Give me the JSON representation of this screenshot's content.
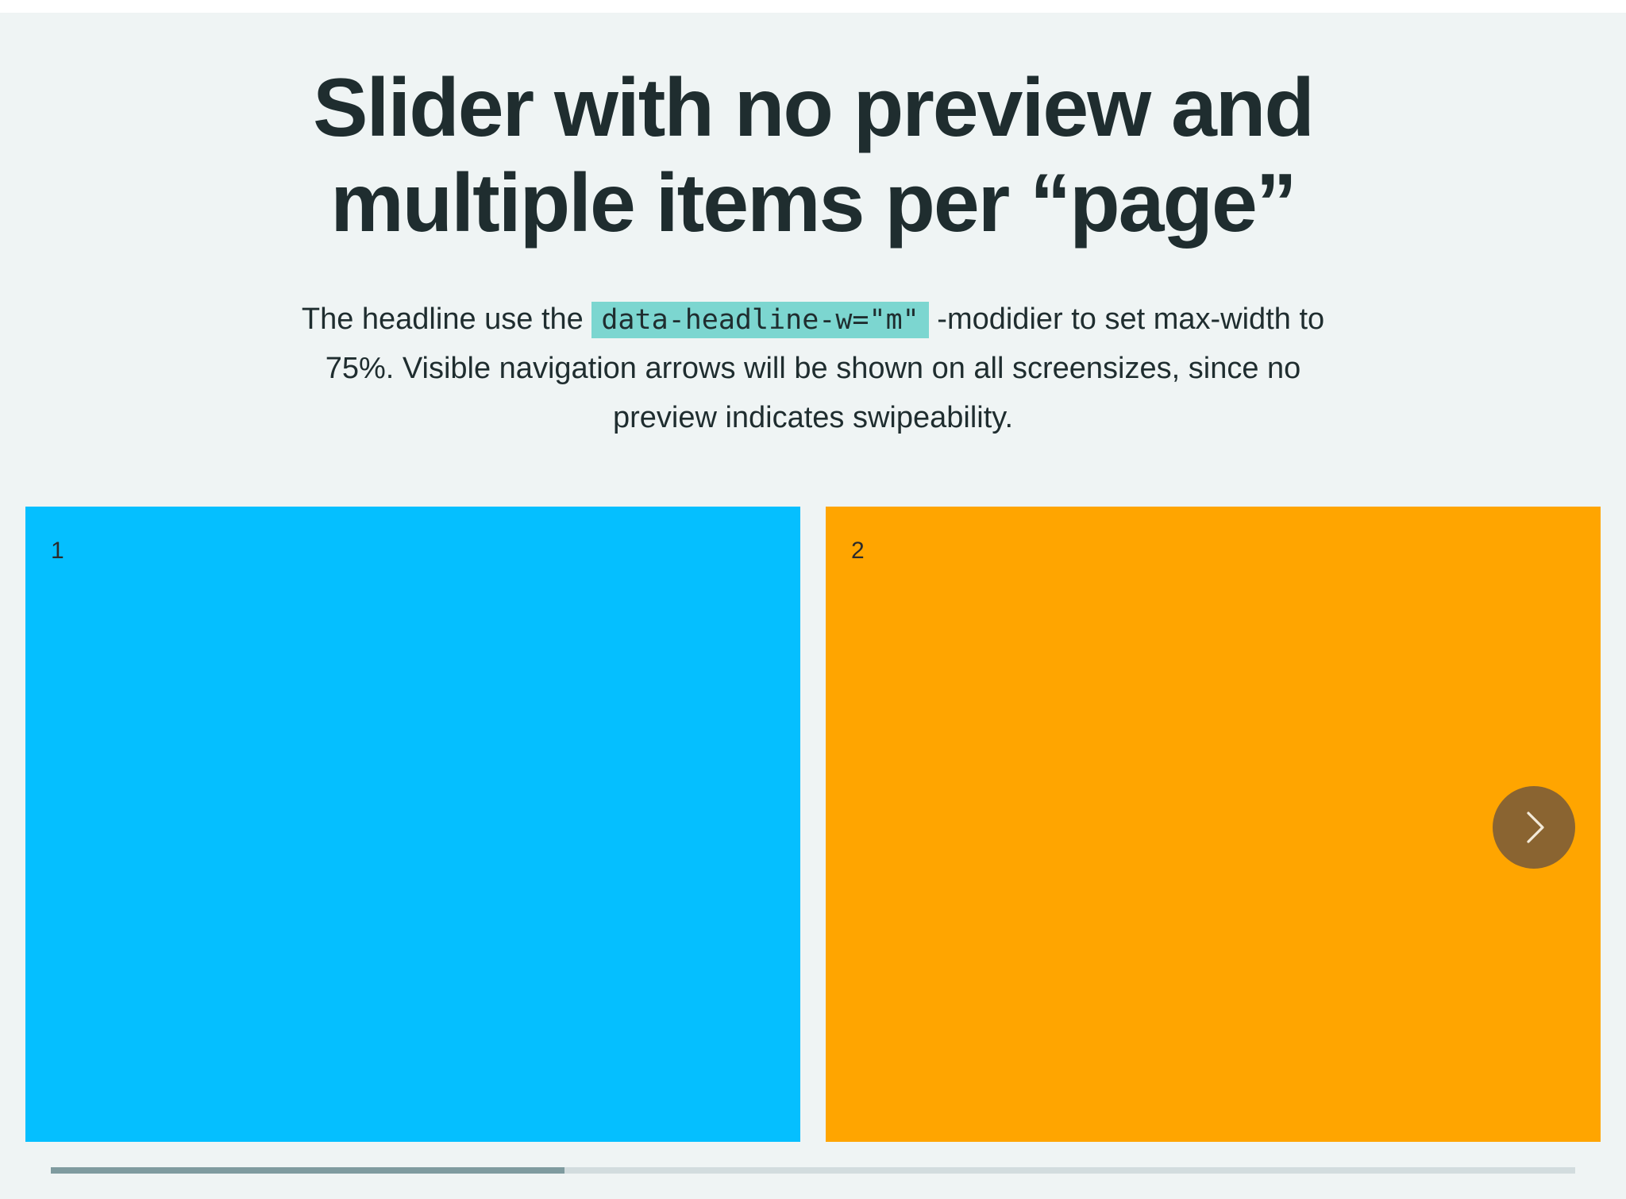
{
  "headline": "Slider with no preview and multiple items per “page”",
  "lead": {
    "before_code": "The headline use the ",
    "code": "data-headline-w=\"m\"",
    "after_code": " -modidier to set max-width to 75%. Visible navigation arrows will be shown on all screensizes, since no preview indicates swipeability."
  },
  "slides": [
    {
      "number": "1",
      "color": "#05bfff"
    },
    {
      "number": "2",
      "color": "#ffa500"
    }
  ],
  "next_button": {
    "icon": "chevron-right-icon"
  },
  "progress": {
    "fraction": 0.337
  }
}
